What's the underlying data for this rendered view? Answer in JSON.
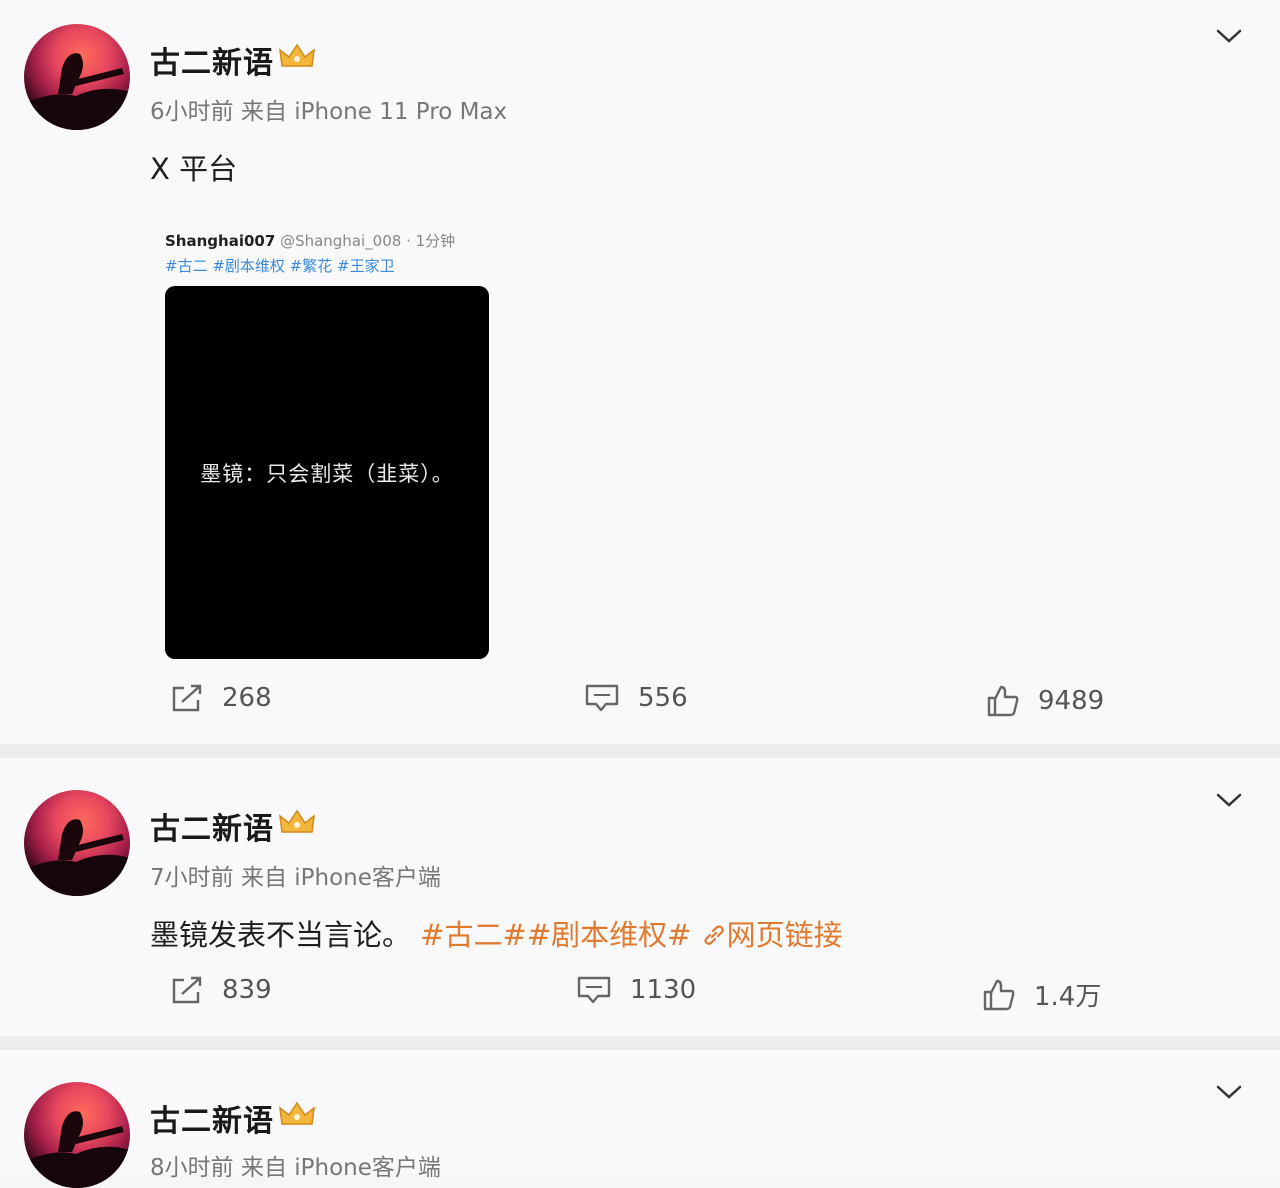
{
  "posts": [
    {
      "author": "古二新语",
      "meta": "6小时前  来自 iPhone 11 Pro Max",
      "text": "X 平台",
      "embed": {
        "handle": "Shanghai007",
        "sub": "@Shanghai_008 · 1分钟",
        "tags": "#古二 #剧本维权 #繁花 #王家卫",
        "image_text": "墨镜：只会割菜（韭菜）。"
      },
      "repost_count": "268",
      "comment_count": "556",
      "like_count": "9489"
    },
    {
      "author": "古二新语",
      "meta": "7小时前  来自 iPhone客户端",
      "text": "墨镜发表不当言论。",
      "tag1": "#古二#",
      "tag2": "#剧本维权#",
      "link": "网页链接",
      "repost_count": "839",
      "comment_count": "1130",
      "like_count": "1.4万"
    },
    {
      "author": "古二新语",
      "meta": "8小时前  来自 iPhone客户端"
    }
  ],
  "colors": {
    "accent": "#e07a2f",
    "tag_blue": "#3b8ad8",
    "meta": "#777777"
  }
}
